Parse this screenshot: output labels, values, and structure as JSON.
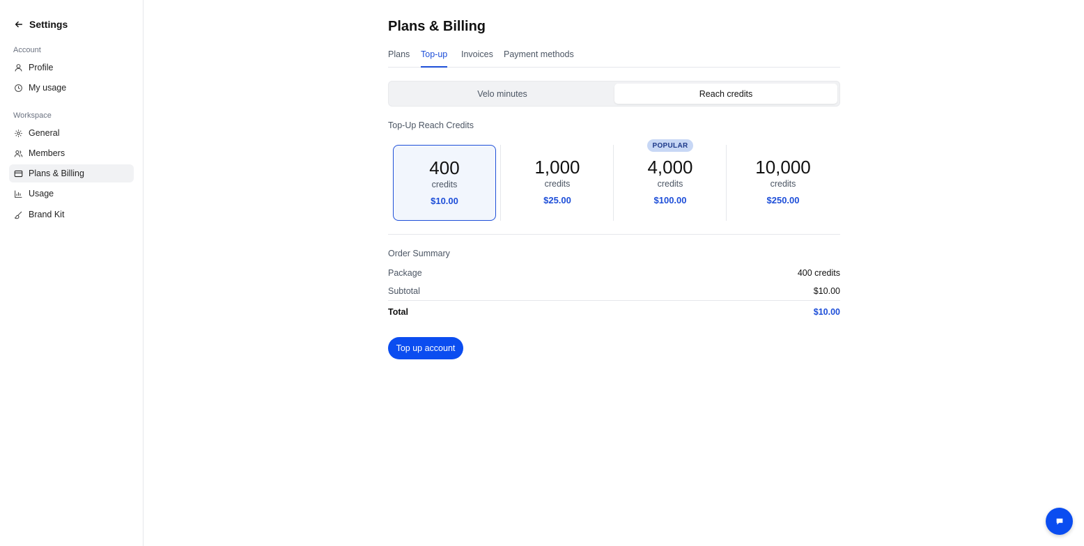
{
  "sidebar": {
    "title": "Settings",
    "sections": {
      "account": "Account",
      "workspace": "Workspace"
    },
    "items": [
      {
        "label": "Profile",
        "icon": "user-icon"
      },
      {
        "label": "My usage",
        "icon": "clock-icon"
      },
      {
        "label": "General",
        "icon": "gear-icon"
      },
      {
        "label": "Members",
        "icon": "users-icon"
      },
      {
        "label": "Plans & Billing",
        "icon": "credit-card-icon",
        "active": true
      },
      {
        "label": "Usage",
        "icon": "bar-chart-icon"
      },
      {
        "label": "Brand Kit",
        "icon": "brush-icon"
      }
    ]
  },
  "page": {
    "title": "Plans & Billing",
    "tabs": [
      {
        "label": "Plans"
      },
      {
        "label": "Top-up",
        "active": true
      },
      {
        "label": "Invoices"
      },
      {
        "label": "Payment methods"
      }
    ],
    "segment": {
      "options": [
        "Velo minutes",
        "Reach credits"
      ],
      "selected": "Reach credits"
    },
    "section_title": "Top-Up Reach Credits",
    "packages": [
      {
        "amount": "400",
        "unit": "credits",
        "price": "$10.00",
        "selected": true
      },
      {
        "amount": "1,000",
        "unit": "credits",
        "price": "$25.00"
      },
      {
        "amount": "4,000",
        "unit": "credits",
        "price": "$100.00",
        "badge": "POPULAR"
      },
      {
        "amount": "10,000",
        "unit": "credits",
        "price": "$250.00"
      }
    ],
    "order_summary": {
      "title": "Order Summary",
      "package_label": "Package",
      "package_value": "400 credits",
      "subtotal_label": "Subtotal",
      "subtotal_value": "$10.00",
      "total_label": "Total",
      "total_value": "$10.00"
    },
    "cta_label": "Top up account"
  },
  "colors": {
    "accent": "#1d4ed8",
    "button": "#0b4df0",
    "badge_bg": "#c7d7f5"
  }
}
